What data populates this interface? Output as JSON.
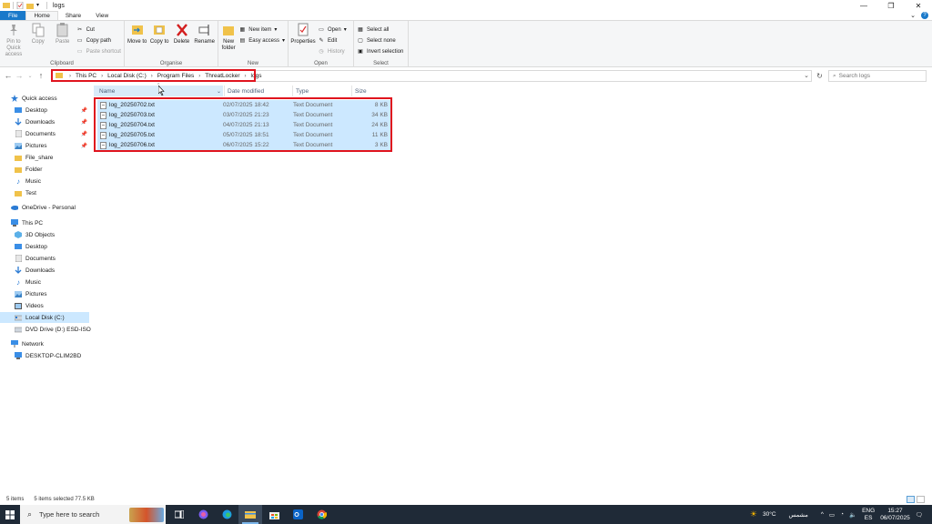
{
  "window": {
    "title": "logs",
    "controls": {
      "minimize": "—",
      "maximize": "❐",
      "close": "✕"
    }
  },
  "ribbon_tabs": [
    {
      "label": "File"
    },
    {
      "label": "Home"
    },
    {
      "label": "Share"
    },
    {
      "label": "View"
    }
  ],
  "ribbon": {
    "clipboard": {
      "label": "Clipboard",
      "pin_to_quick_access": "Pin to Quick access",
      "copy": "Copy",
      "paste": "Paste",
      "cut": "Cut",
      "copy_path": "Copy path",
      "paste_shortcut": "Paste shortcut"
    },
    "organise": {
      "label": "Organise",
      "move_to": "Move to",
      "copy_to": "Copy to",
      "delete": "Delete",
      "rename": "Rename"
    },
    "new": {
      "label": "New",
      "new_folder": "New folder",
      "new_item": "New item",
      "easy_access": "Easy access"
    },
    "open": {
      "label": "Open",
      "properties": "Properties",
      "open": "Open",
      "edit": "Edit",
      "history": "History"
    },
    "select": {
      "label": "Select",
      "select_all": "Select all",
      "select_none": "Select none",
      "invert_selection": "Invert selection"
    }
  },
  "address_bar": {
    "crumbs": [
      "This PC",
      "Local Disk (C:)",
      "Program Files",
      "ThreatLocker",
      "logs"
    ]
  },
  "search": {
    "placeholder": "Search logs"
  },
  "nav_pane": {
    "quick_access": "Quick access",
    "quick_items": [
      "Desktop",
      "Downloads",
      "Documents",
      "Pictures",
      "File_share",
      "Folder",
      "Music",
      "Test"
    ],
    "onedrive": "OneDrive - Personal",
    "this_pc": "This PC",
    "pc_items": [
      "3D Objects",
      "Desktop",
      "Documents",
      "Downloads",
      "Music",
      "Pictures",
      "Videos",
      "Local Disk (C:)",
      "DVD Drive (D:) ESD-ISO"
    ],
    "network": "Network",
    "network_items": [
      "DESKTOP-CLIM2BD"
    ]
  },
  "columns": {
    "name": "Name",
    "date": "Date modified",
    "type": "Type",
    "size": "Size"
  },
  "files": [
    {
      "name": "log_20250702.txt",
      "date": "02/07/2025 18:42",
      "type": "Text Document",
      "size": "8 KB"
    },
    {
      "name": "log_20250703.txt",
      "date": "03/07/2025 21:23",
      "type": "Text Document",
      "size": "34 KB"
    },
    {
      "name": "log_20250704.txt",
      "date": "04/07/2025 21:13",
      "type": "Text Document",
      "size": "24 KB"
    },
    {
      "name": "log_20250705.txt",
      "date": "05/07/2025 18:51",
      "type": "Text Document",
      "size": "11 KB"
    },
    {
      "name": "log_20250706.txt",
      "date": "06/07/2025 15:22",
      "type": "Text Document",
      "size": "3 KB"
    }
  ],
  "status": {
    "count": "5 items",
    "selected": "5 items selected  77.5 KB"
  },
  "taskbar": {
    "search_placeholder": "Type here to search",
    "weather_temp": "30°C",
    "weather_text": "مشمس",
    "lang_top": "ENG",
    "lang_bottom": "ES",
    "time": "15:27",
    "date": "06/07/2025"
  },
  "colors": {
    "accent": "#1979ca",
    "highlight": "#e0141e",
    "selection": "#cce8ff",
    "taskbar": "#1f2a37"
  }
}
